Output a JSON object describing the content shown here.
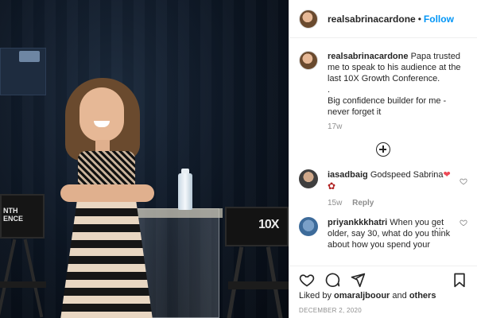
{
  "post_image": {
    "chair_left_label": "NTH\nENCE",
    "chair_right_label": "10X"
  },
  "header": {
    "username": "realsabrinacardone",
    "separator": "•",
    "follow_label": "Follow"
  },
  "caption": {
    "username": "realsabrinacardone",
    "text": "Papa trusted me to speak to his audience at the last 10X Growth Conference.",
    "line2": ".",
    "line3": "Big confidence builder for me - never forget it",
    "time": "17w"
  },
  "comments": [
    {
      "username": "iasadbaig",
      "text": "Godspeed Sabrina",
      "time": "15w",
      "reply_label": "Reply"
    },
    {
      "username": "priyankkkhatri",
      "text": "When you get older, say 30, what do you think about how you spend your",
      "more": "…"
    }
  ],
  "likes": {
    "prefix": "Liked by",
    "user": "omaraljboour",
    "and": "and",
    "others": "others"
  },
  "date": "DECEMBER 2, 2020",
  "colors": {
    "follow": "#0095f6",
    "heart": "#ed4956",
    "muted": "#8e8e8e"
  }
}
